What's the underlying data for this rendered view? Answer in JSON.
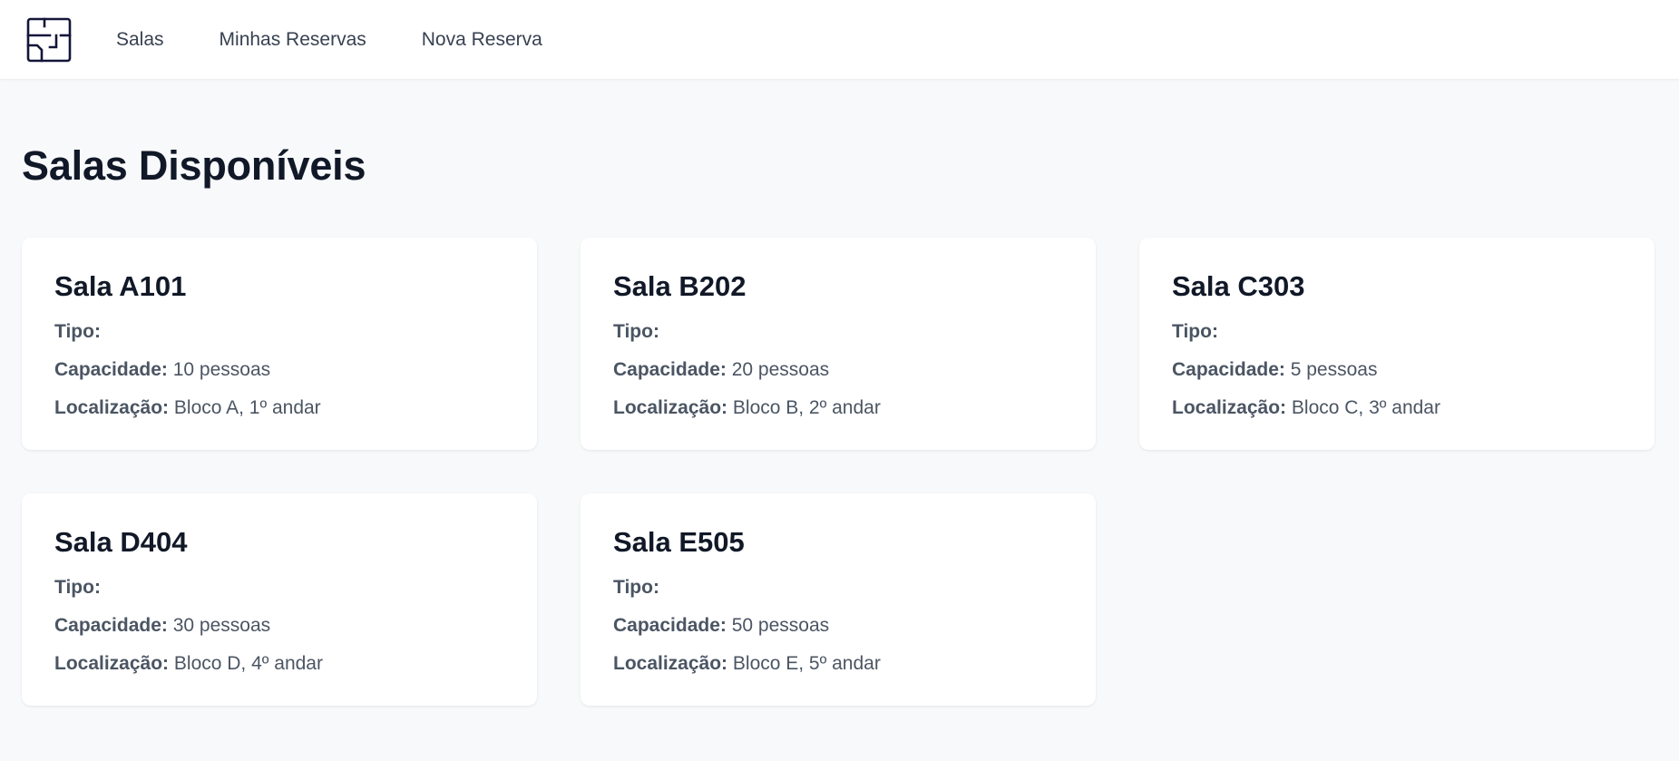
{
  "nav": {
    "logo_icon": "floor-plan-icon",
    "links": [
      {
        "label": "Salas"
      },
      {
        "label": "Minhas Reservas"
      },
      {
        "label": "Nova Reserva"
      }
    ]
  },
  "main": {
    "title": "Salas Disponíveis",
    "labels": {
      "tipo": "Tipo:",
      "capacidade": "Capacidade:",
      "localizacao": "Localização:"
    },
    "rooms": [
      {
        "name": "Sala A101",
        "tipo": "",
        "capacidade": "10 pessoas",
        "localizacao": "Bloco A, 1º andar"
      },
      {
        "name": "Sala B202",
        "tipo": "",
        "capacidade": "20 pessoas",
        "localizacao": "Bloco B, 2º andar"
      },
      {
        "name": "Sala C303",
        "tipo": "",
        "capacidade": "5 pessoas",
        "localizacao": "Bloco C, 3º andar"
      },
      {
        "name": "Sala D404",
        "tipo": "",
        "capacidade": "30 pessoas",
        "localizacao": "Bloco D, 4º andar"
      },
      {
        "name": "Sala E505",
        "tipo": "",
        "capacidade": "50 pessoas",
        "localizacao": "Bloco E, 5º andar"
      }
    ]
  },
  "colors": {
    "background": "#f8f9fb",
    "surface": "#ffffff",
    "text_primary": "#111827",
    "text_secondary": "#4b5563",
    "logo": "#14153a"
  }
}
